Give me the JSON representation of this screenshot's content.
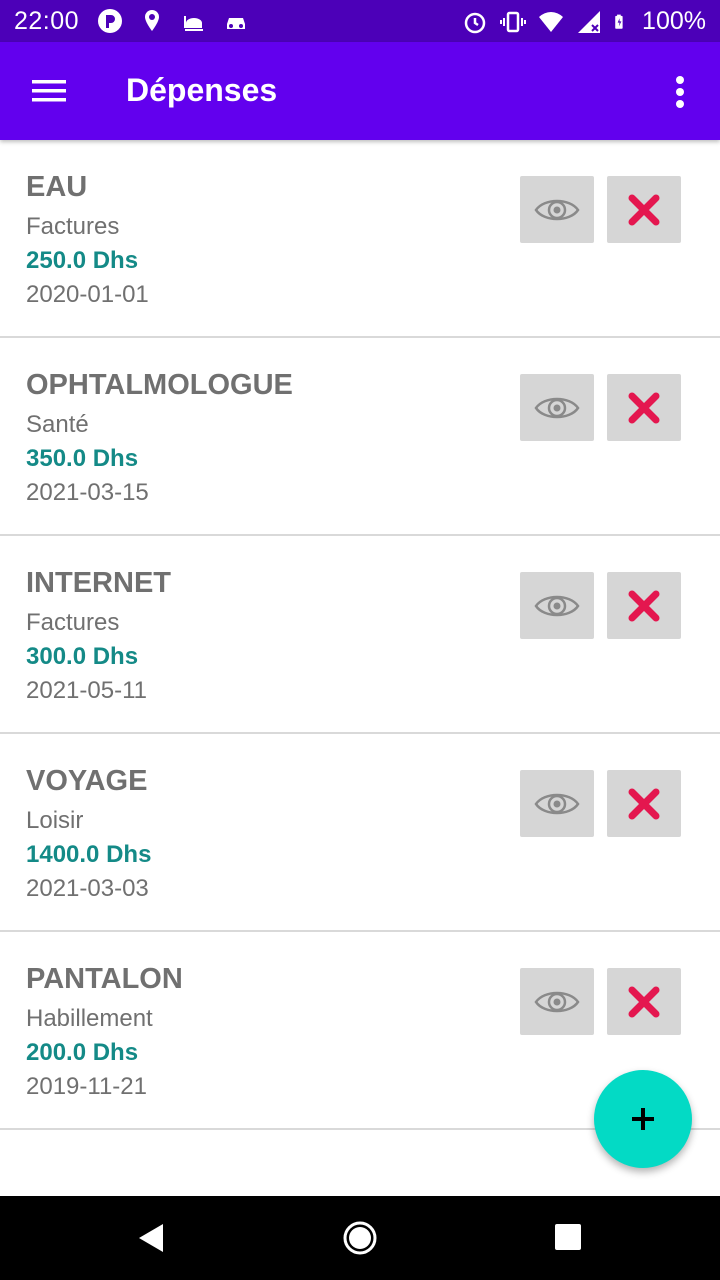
{
  "status_bar": {
    "time": "22:00",
    "battery": "100%",
    "left_icons": [
      "parking-icon",
      "location-pin-icon",
      "mosque-icon",
      "car-icon"
    ],
    "right_icons": [
      "alarm-icon",
      "vibrate-icon",
      "wifi-icon",
      "signal-icon",
      "battery-icon"
    ]
  },
  "app_bar": {
    "title": "Dépenses",
    "color": "#6200ee"
  },
  "expenses": [
    {
      "name": "EAU",
      "category": "Factures",
      "amount": "250.0 Dhs",
      "date": "2020-01-01"
    },
    {
      "name": "OPHTALMOLOGUE",
      "category": "Santé",
      "amount": "350.0 Dhs",
      "date": "2021-03-15"
    },
    {
      "name": "INTERNET",
      "category": "Factures",
      "amount": "300.0 Dhs",
      "date": "2021-05-11"
    },
    {
      "name": "VOYAGE",
      "category": "Loisir",
      "amount": "1400.0 Dhs",
      "date": "2021-03-03"
    },
    {
      "name": "PANTALON",
      "category": "Habillement",
      "amount": "200.0 Dhs",
      "date": "2019-11-21"
    }
  ],
  "colors": {
    "amount": "#148a87",
    "delete_icon": "#e4174f",
    "fab": "#03dac5"
  },
  "fab": {
    "icon": "plus-icon"
  },
  "nav_bar": {
    "icons": [
      "back-icon",
      "home-icon",
      "recents-icon"
    ]
  }
}
